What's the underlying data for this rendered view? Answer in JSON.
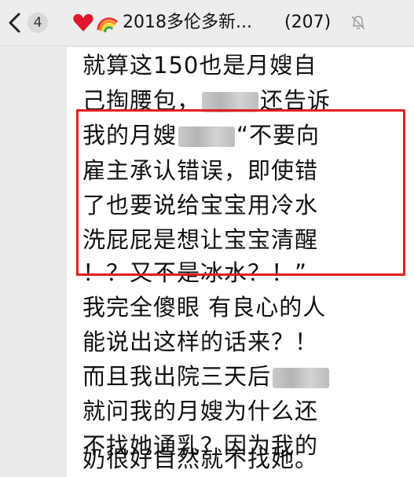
{
  "header": {
    "back_icon": "chevron-left-icon",
    "unread_count": "4",
    "title_icons": [
      "heart-icon",
      "rainbow-icon"
    ],
    "title": "2018多伦多新...",
    "member_count": "(207)",
    "mute_icon": "mute-bell-icon"
  },
  "message": {
    "lines": [
      "就算这150也是月嫂自",
      "己掏腰包，",
      "还告诉",
      "我的月嫂",
      "“不要向",
      "雇主承认错误，即使错",
      "了也要说给宝宝用冷水",
      "洗屁屁是想让宝宝清醒",
      "！？又不是冰水？！”",
      "我完全傻眼 有良心的人",
      "能说出这样的话来？！",
      "而且我出院三天后",
      "就问我的月嫂为什么还",
      "不找她通乳？因为我的",
      "奶很好自然就不找她。"
    ]
  },
  "colors": {
    "highlight": "#e02020",
    "background": "#ebebeb",
    "bubble": "#ffffff"
  }
}
